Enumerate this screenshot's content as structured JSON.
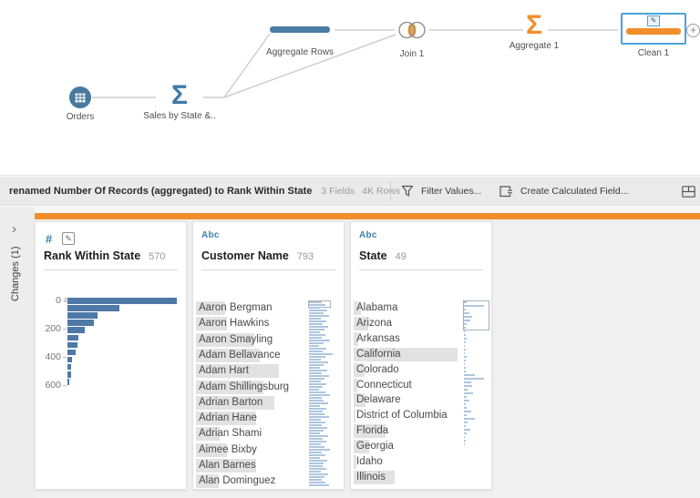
{
  "flow": {
    "nodes": [
      {
        "label": "Orders"
      },
      {
        "label": "Sales by State &.."
      },
      {
        "label": "Aggregate Rows"
      },
      {
        "label": "Join 1"
      },
      {
        "label": "Aggregate 1"
      },
      {
        "label": "Clean 1"
      }
    ],
    "add_button": "+"
  },
  "toolbar": {
    "status_text": "renamed Number Of Records (aggregated) to Rank Within State",
    "fields_count": "3 Fields",
    "rows_count": "4K Rows",
    "filter_label": "Filter Values...",
    "calc_label": "Create Calculated Field..."
  },
  "sidebar": {
    "label": "Changes (1)",
    "chevron": "›"
  },
  "columns": [
    {
      "type": "#",
      "name": "Rank Within State",
      "count": "570"
    },
    {
      "type": "Abc",
      "name": "Customer Name",
      "count": "793",
      "values": [
        {
          "text": "Aaron Bergman",
          "freq": 32
        },
        {
          "text": "Aaron Hawkins",
          "freq": 34
        },
        {
          "text": "Aaron Smayling",
          "freq": 64
        },
        {
          "text": "Adam Bellavance",
          "freq": 70
        },
        {
          "text": "Adam Hart",
          "freq": 91
        },
        {
          "text": "Adam Shillingsburg",
          "freq": 74
        },
        {
          "text": "Adrian Barton",
          "freq": 86
        },
        {
          "text": "Adrian Hane",
          "freq": 66
        },
        {
          "text": "Adrian Shami",
          "freq": 26
        },
        {
          "text": "Aimee Bixby",
          "freq": 34
        },
        {
          "text": "Alan Barnes",
          "freq": 66
        },
        {
          "text": "Alan Dominguez",
          "freq": 25
        }
      ],
      "strip": [
        14,
        18,
        12,
        20,
        16,
        22,
        13,
        19,
        15,
        21,
        17,
        12,
        18,
        14,
        23,
        16,
        11,
        19,
        15,
        26,
        18,
        13,
        21,
        16,
        12,
        20,
        14,
        22,
        17,
        13,
        19,
        15,
        11,
        18,
        23,
        14,
        16,
        21,
        12,
        19,
        15,
        17,
        22,
        13,
        18,
        14,
        20,
        16,
        12,
        21,
        15,
        19,
        13,
        17,
        23,
        14,
        18,
        12,
        20,
        16,
        15,
        19,
        13,
        21,
        17,
        14,
        18,
        22
      ]
    },
    {
      "type": "Abc",
      "name": "State",
      "count": "49",
      "values": [
        {
          "text": "Alabama",
          "freq": 8
        },
        {
          "text": "Arizona",
          "freq": 16
        },
        {
          "text": "Arkansas",
          "freq": 5
        },
        {
          "text": "California",
          "freq": 114
        },
        {
          "text": "Colorado",
          "freq": 12
        },
        {
          "text": "Connecticut",
          "freq": 4
        },
        {
          "text": "Delaware",
          "freq": 13
        },
        {
          "text": "District of Columbia",
          "freq": 2
        },
        {
          "text": "Florida",
          "freq": 35
        },
        {
          "text": "Georgia",
          "freq": 17
        },
        {
          "text": "Idaho",
          "freq": 3
        },
        {
          "text": "Illinois",
          "freq": 45
        }
      ],
      "strip": [
        3,
        22,
        2,
        6,
        9,
        7,
        3,
        2,
        1,
        2,
        3,
        2,
        1,
        2,
        1,
        3,
        2,
        1,
        2,
        2,
        12,
        22,
        8,
        9,
        4,
        10,
        3,
        6,
        2,
        3,
        8,
        3,
        12,
        4,
        2,
        7,
        3,
        1,
        2,
        1,
        0,
        0,
        0,
        0,
        0,
        0,
        0,
        0
      ]
    }
  ],
  "chart_data": {
    "type": "bar",
    "orientation": "horizontal",
    "title": "Rank Within State distribution",
    "y_tick_labels": [
      "0",
      "200",
      "400",
      "600"
    ],
    "values": [
      120,
      57,
      33,
      29,
      19,
      12,
      11,
      9,
      5,
      3.5,
      3.5,
      2
    ],
    "xlabel": "",
    "ylabel": "Rank Within State",
    "legend": false,
    "grid": false
  },
  "colors": {
    "accent_orange": "#f28e2b",
    "node_blue": "#47789f",
    "selection_blue": "#4ba3db",
    "histogram_blue": "#4e79a7",
    "strip_blue": "#adc6e0",
    "freq_gray": "#e2e2e2",
    "type_blue": "#3d7fae"
  }
}
